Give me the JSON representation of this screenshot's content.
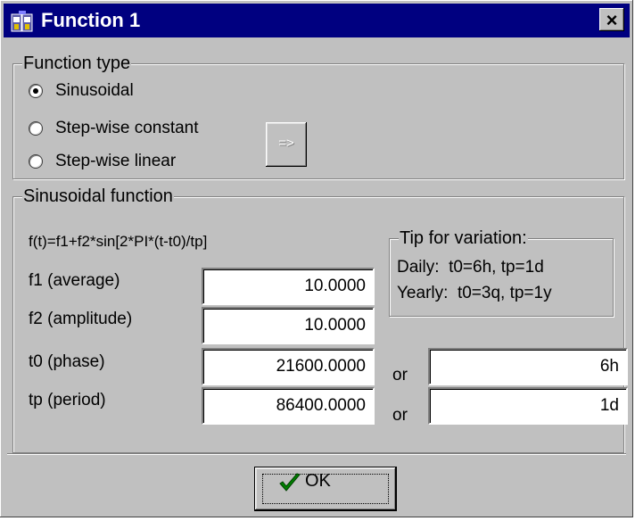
{
  "window": {
    "title": "Function 1",
    "close_label": "×"
  },
  "function_type": {
    "legend": "Function type",
    "options": [
      "Sinusoidal",
      "Step-wise constant",
      "Step-wise linear"
    ],
    "selected": "Sinusoidal",
    "edit_button_label": "=>"
  },
  "sinusoidal": {
    "legend": "Sinusoidal function",
    "formula": "f(t)=f1+f2*sin[2*PI*(t-t0)/tp]",
    "tip": {
      "legend": "Tip for variation:",
      "daily": "Daily:  t0=6h, tp=1d",
      "yearly": "Yearly:  t0=3q, tp=1y"
    },
    "fields": [
      {
        "label": "f1 (average)",
        "value": "10.0000"
      },
      {
        "label": "f2 (amplitude)",
        "value": "10.0000"
      },
      {
        "label": "t0 (phase)",
        "value": "21600.0000",
        "or": "or",
        "alt_value": "6h"
      },
      {
        "label": "tp (period)",
        "value": "86400.0000",
        "or": "or",
        "alt_value": "1d"
      }
    ]
  },
  "ok_label": "OK",
  "colors": {
    "title_bar": "#000080",
    "face": "#c0c0c0",
    "check": "#008000"
  }
}
